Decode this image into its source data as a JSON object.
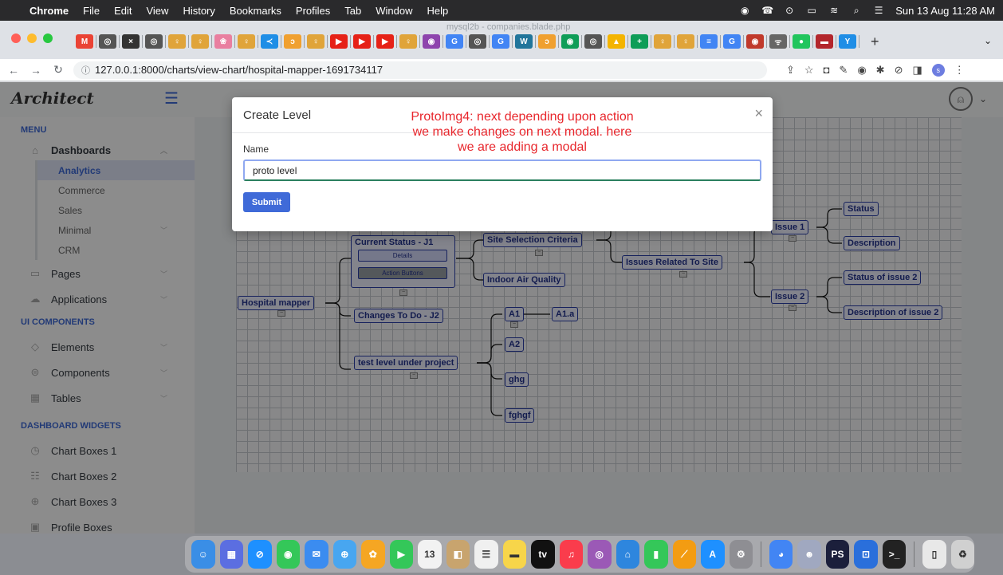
{
  "menubar": {
    "app": "Chrome",
    "items": [
      "File",
      "Edit",
      "View",
      "History",
      "Bookmarks",
      "Profiles",
      "Tab",
      "Window",
      "Help"
    ],
    "datetime": "Sun 13 Aug  11:28 AM"
  },
  "browser": {
    "window_title": "mysql2b - companies.blade.php",
    "url": "127.0.0.1:8000/charts/view-chart/hospital-mapper-1691734117",
    "tab_icons": [
      {
        "label": "M",
        "color": "#ea4335"
      },
      {
        "label": "◎",
        "color": "#555"
      },
      {
        "label": "×",
        "color": "#333"
      },
      {
        "label": "◎",
        "color": "#555"
      },
      {
        "label": "♀",
        "color": "#e0a43a"
      },
      {
        "label": "♀",
        "color": "#e0a43a"
      },
      {
        "label": "❀",
        "color": "#e97fa0"
      },
      {
        "label": "♀",
        "color": "#e0a43a"
      },
      {
        "label": "≺",
        "color": "#1f8ee6"
      },
      {
        "label": "ᴐ",
        "color": "#f0a030"
      },
      {
        "label": "♀",
        "color": "#e0a43a"
      },
      {
        "label": "▶",
        "color": "#e62117"
      },
      {
        "label": "▶",
        "color": "#e62117"
      },
      {
        "label": "▶",
        "color": "#e62117"
      },
      {
        "label": "♀",
        "color": "#e0a43a"
      },
      {
        "label": "◉",
        "color": "#8e44ad"
      },
      {
        "label": "G",
        "color": "#4285f4"
      },
      {
        "label": "◎",
        "color": "#555"
      },
      {
        "label": "G",
        "color": "#4285f4"
      },
      {
        "label": "W",
        "color": "#21759b"
      },
      {
        "label": "ᴐ",
        "color": "#f0a030"
      },
      {
        "label": "◉",
        "color": "#0f9d58"
      },
      {
        "label": "◎",
        "color": "#555"
      },
      {
        "label": "▲",
        "color": "#f4b400"
      },
      {
        "label": "+",
        "color": "#0f9d58"
      },
      {
        "label": "♀",
        "color": "#e0a43a"
      },
      {
        "label": "♀",
        "color": "#e0a43a"
      },
      {
        "label": "≡",
        "color": "#4285f4"
      },
      {
        "label": "G",
        "color": "#4285f4"
      },
      {
        "label": "◉",
        "color": "#c0392b"
      },
      {
        "label": "ᯤ",
        "color": "#666"
      },
      {
        "label": "●",
        "color": "#21c55d"
      },
      {
        "label": "▬",
        "color": "#b3262c"
      },
      {
        "label": "Y",
        "color": "#1f8ee6"
      }
    ]
  },
  "app": {
    "logo": "Architect",
    "sidebar": {
      "menu_label": "MENU",
      "dashboards": "Dashboards",
      "dashboard_items": [
        "Analytics",
        "Commerce",
        "Sales",
        "Minimal",
        "CRM"
      ],
      "pages": "Pages",
      "applications": "Applications",
      "ui_label": "UI COMPONENTS",
      "ui_items": [
        "Elements",
        "Components",
        "Tables"
      ],
      "widgets_label": "DASHBOARD WIDGETS",
      "widget_items": [
        "Chart Boxes 1",
        "Chart Boxes 2",
        "Chart Boxes 3",
        "Profile Boxes"
      ]
    }
  },
  "mindmap": {
    "root": "Hospital mapper",
    "current_status": "Current Status - J1",
    "details_btn": "Details",
    "action_btn": "Action Buttons",
    "changes": "Changes To Do - J2",
    "test_level": "test level under project",
    "site_selection": "Site Selection Criteria",
    "indoor_air": "Indoor Air Quality",
    "issues_site": "Issues Related To Site",
    "a1": "A1",
    "a1a": "A1.a",
    "a2": "A2",
    "ghg": "ghg",
    "fghgf": "fghgf",
    "issue1": "Issue 1",
    "issue2": "Issue 2",
    "status": "Status",
    "description": "Description",
    "status2": "Status of issue 2",
    "description2": "Description of issue 2",
    "collapse": "−"
  },
  "modal": {
    "title": "Create Level",
    "close": "×",
    "name_label": "Name",
    "name_value": "proto level",
    "submit": "Submit"
  },
  "annotation": "ProtoImg4: next depending upon action we make changes on next modal. here we are adding a modal",
  "dock": [
    {
      "label": "☺",
      "color": "#3a8ee6"
    },
    {
      "label": "▦",
      "color": "#5b6ee1"
    },
    {
      "label": "⊘",
      "color": "#1e90ff"
    },
    {
      "label": "◉",
      "color": "#34c759"
    },
    {
      "label": "✉",
      "color": "#3b8cf0"
    },
    {
      "label": "⊕",
      "color": "#48a6f0"
    },
    {
      "label": "✿",
      "color": "#f5a623"
    },
    {
      "label": "▶",
      "color": "#34c759"
    },
    {
      "label": "13",
      "color": "#f2f2f2"
    },
    {
      "label": "◧",
      "color": "#c8a46e"
    },
    {
      "label": "☰",
      "color": "#f0f0f0"
    },
    {
      "label": "▬",
      "color": "#f7d54a"
    },
    {
      "label": "tv",
      "color": "#111"
    },
    {
      "label": "♫",
      "color": "#fa3c4c"
    },
    {
      "label": "◎",
      "color": "#9b59b6"
    },
    {
      "label": "⌂",
      "color": "#2e86de"
    },
    {
      "label": "▮",
      "color": "#34c759"
    },
    {
      "label": "⟋",
      "color": "#f39c12"
    },
    {
      "label": "A",
      "color": "#1e90ff"
    },
    {
      "label": "⚙",
      "color": "#8e8e93"
    },
    {
      "label": "◕",
      "color": "#4285f4"
    },
    {
      "label": "☻",
      "color": "#a0a8c0"
    },
    {
      "label": "PS",
      "color": "#1b1f3b"
    },
    {
      "label": "⊡",
      "color": "#2a6fdb"
    },
    {
      "label": ">_",
      "color": "#222"
    },
    {
      "label": "▯",
      "color": "#e8e8e8"
    },
    {
      "label": "♻",
      "color": "#d0d0d0"
    }
  ]
}
